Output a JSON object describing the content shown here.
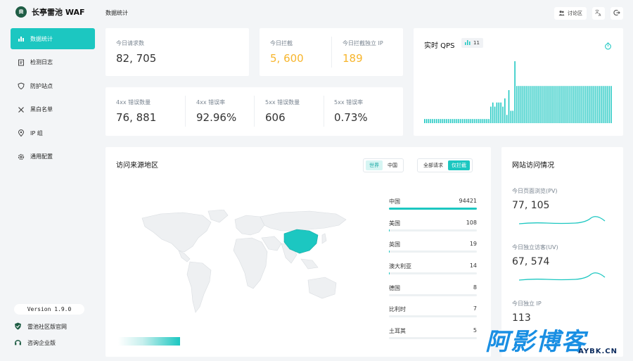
{
  "app": {
    "title": "长亭雷池 WAF",
    "page_title": "数据统计"
  },
  "sidebar": {
    "items": [
      {
        "label": "数据统计",
        "icon": "bar-chart-icon",
        "active": true
      },
      {
        "label": "检测日志",
        "icon": "log-icon",
        "active": false
      },
      {
        "label": "防护站点",
        "icon": "shield-icon",
        "active": false
      },
      {
        "label": "黑白名单",
        "icon": "tools-icon",
        "active": false
      },
      {
        "label": "IP 组",
        "icon": "location-icon",
        "active": false
      },
      {
        "label": "通用配置",
        "icon": "gear-icon",
        "active": false
      }
    ],
    "version": "Version 1.9.0",
    "links": [
      {
        "label": "雷池社区版官网",
        "icon": "shield-check-icon"
      },
      {
        "label": "咨询企业版",
        "icon": "headset-icon"
      }
    ]
  },
  "header": {
    "discuss_label": "讨论区",
    "icons": [
      "people-icon",
      "language-icon",
      "logout-icon"
    ]
  },
  "stats": {
    "requests_label": "今日请求数",
    "requests_value": "82, 705",
    "blocked_label": "今日拦截",
    "blocked_value": "5, 600",
    "blocked_ip_label": "今日拦截独立 IP",
    "blocked_ip_value": "189",
    "err4_count_label": "4xx 错误数量",
    "err4_count_value": "76, 881",
    "err4_rate_label": "4xx 错误率",
    "err4_rate_value": "92.96%",
    "err5_count_label": "5xx 错误数量",
    "err5_count_value": "606",
    "err5_rate_label": "5xx 错误率",
    "err5_rate_value": "0.73%"
  },
  "qps": {
    "title": "实时 QPS",
    "badge": "11",
    "bars": [
      1,
      1,
      1,
      1,
      1,
      1,
      1,
      1,
      1,
      1,
      1,
      1,
      1,
      1,
      1,
      1,
      1,
      1,
      1,
      1,
      1,
      1,
      1,
      1,
      1,
      1,
      1,
      1,
      1,
      1,
      1,
      1,
      1,
      4,
      5,
      4,
      5,
      5,
      5,
      4,
      6,
      2,
      8,
      3,
      3,
      15,
      9,
      9,
      9,
      9,
      9,
      9,
      9,
      9,
      9,
      9,
      9,
      9,
      9,
      9,
      9,
      9,
      9,
      9,
      9,
      9,
      9,
      9,
      9,
      9,
      9,
      9,
      9,
      9,
      9,
      9,
      9,
      9,
      9,
      9,
      9,
      9,
      9,
      9,
      9,
      9,
      9,
      9,
      9,
      9,
      9,
      9,
      9,
      9
    ]
  },
  "geo": {
    "title": "访问来源地区",
    "scope_options": [
      "世界",
      "中国"
    ],
    "filter_options": [
      "全部请求",
      "仅拦截"
    ],
    "ranking": [
      {
        "name": "中国",
        "count": "94421",
        "ratio": 1.0
      },
      {
        "name": "美国",
        "count": "108",
        "ratio": 0.004
      },
      {
        "name": "英国",
        "count": "19",
        "ratio": 0.001
      },
      {
        "name": "澳大利亚",
        "count": "14",
        "ratio": 0.001
      },
      {
        "name": "德国",
        "count": "8",
        "ratio": 0.0005
      },
      {
        "name": "比利时",
        "count": "7",
        "ratio": 0.0005
      },
      {
        "name": "土耳其",
        "count": "5",
        "ratio": 0.0003
      }
    ]
  },
  "site": {
    "title": "网站访问情况",
    "pv_label": "今日页面浏览(PV)",
    "pv_value": "77, 105",
    "uv_label": "今日独立访客(UV)",
    "uv_value": "67, 574",
    "ip_label": "今日独立 IP",
    "ip_value": "113"
  },
  "watermark": {
    "big": "阿影博客",
    "small": "AYBK.CN"
  },
  "colors": {
    "accent": "#1cc7c1",
    "warn": "#f7b52c",
    "watermark": "#1a8fe3"
  }
}
